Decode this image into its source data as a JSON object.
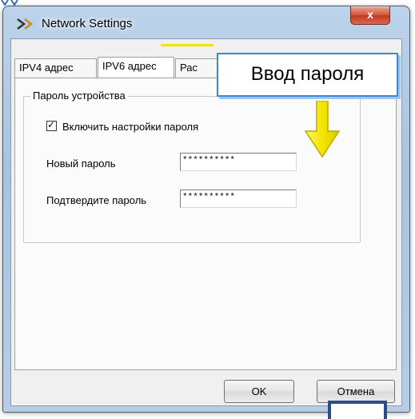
{
  "window": {
    "title": "Network Settings",
    "close_glyph": "x"
  },
  "tabs": [
    {
      "label": "IPV4 адрес"
    },
    {
      "label": "IPV6 адрес"
    },
    {
      "label": "Рас"
    }
  ],
  "password_group": {
    "legend": "Пароль устройства",
    "enable_checkbox_label": "Включить настройки пароля",
    "enable_checked": true,
    "check_glyph": "✓",
    "new_password_label": "Новый пароль",
    "new_password_value": "**********",
    "confirm_password_label": "Подтвердите пароль",
    "confirm_password_value": "**********"
  },
  "buttons": {
    "ok": "OK",
    "cancel": "Отмена"
  },
  "annotation": {
    "callout_text": "Ввод пароля",
    "arrow_color": "#f5e600",
    "callout_border_color": "#3f86d6"
  },
  "icons": [
    "app-icon",
    "close-icon",
    "checkbox-check-icon",
    "down-arrow-icon"
  ]
}
